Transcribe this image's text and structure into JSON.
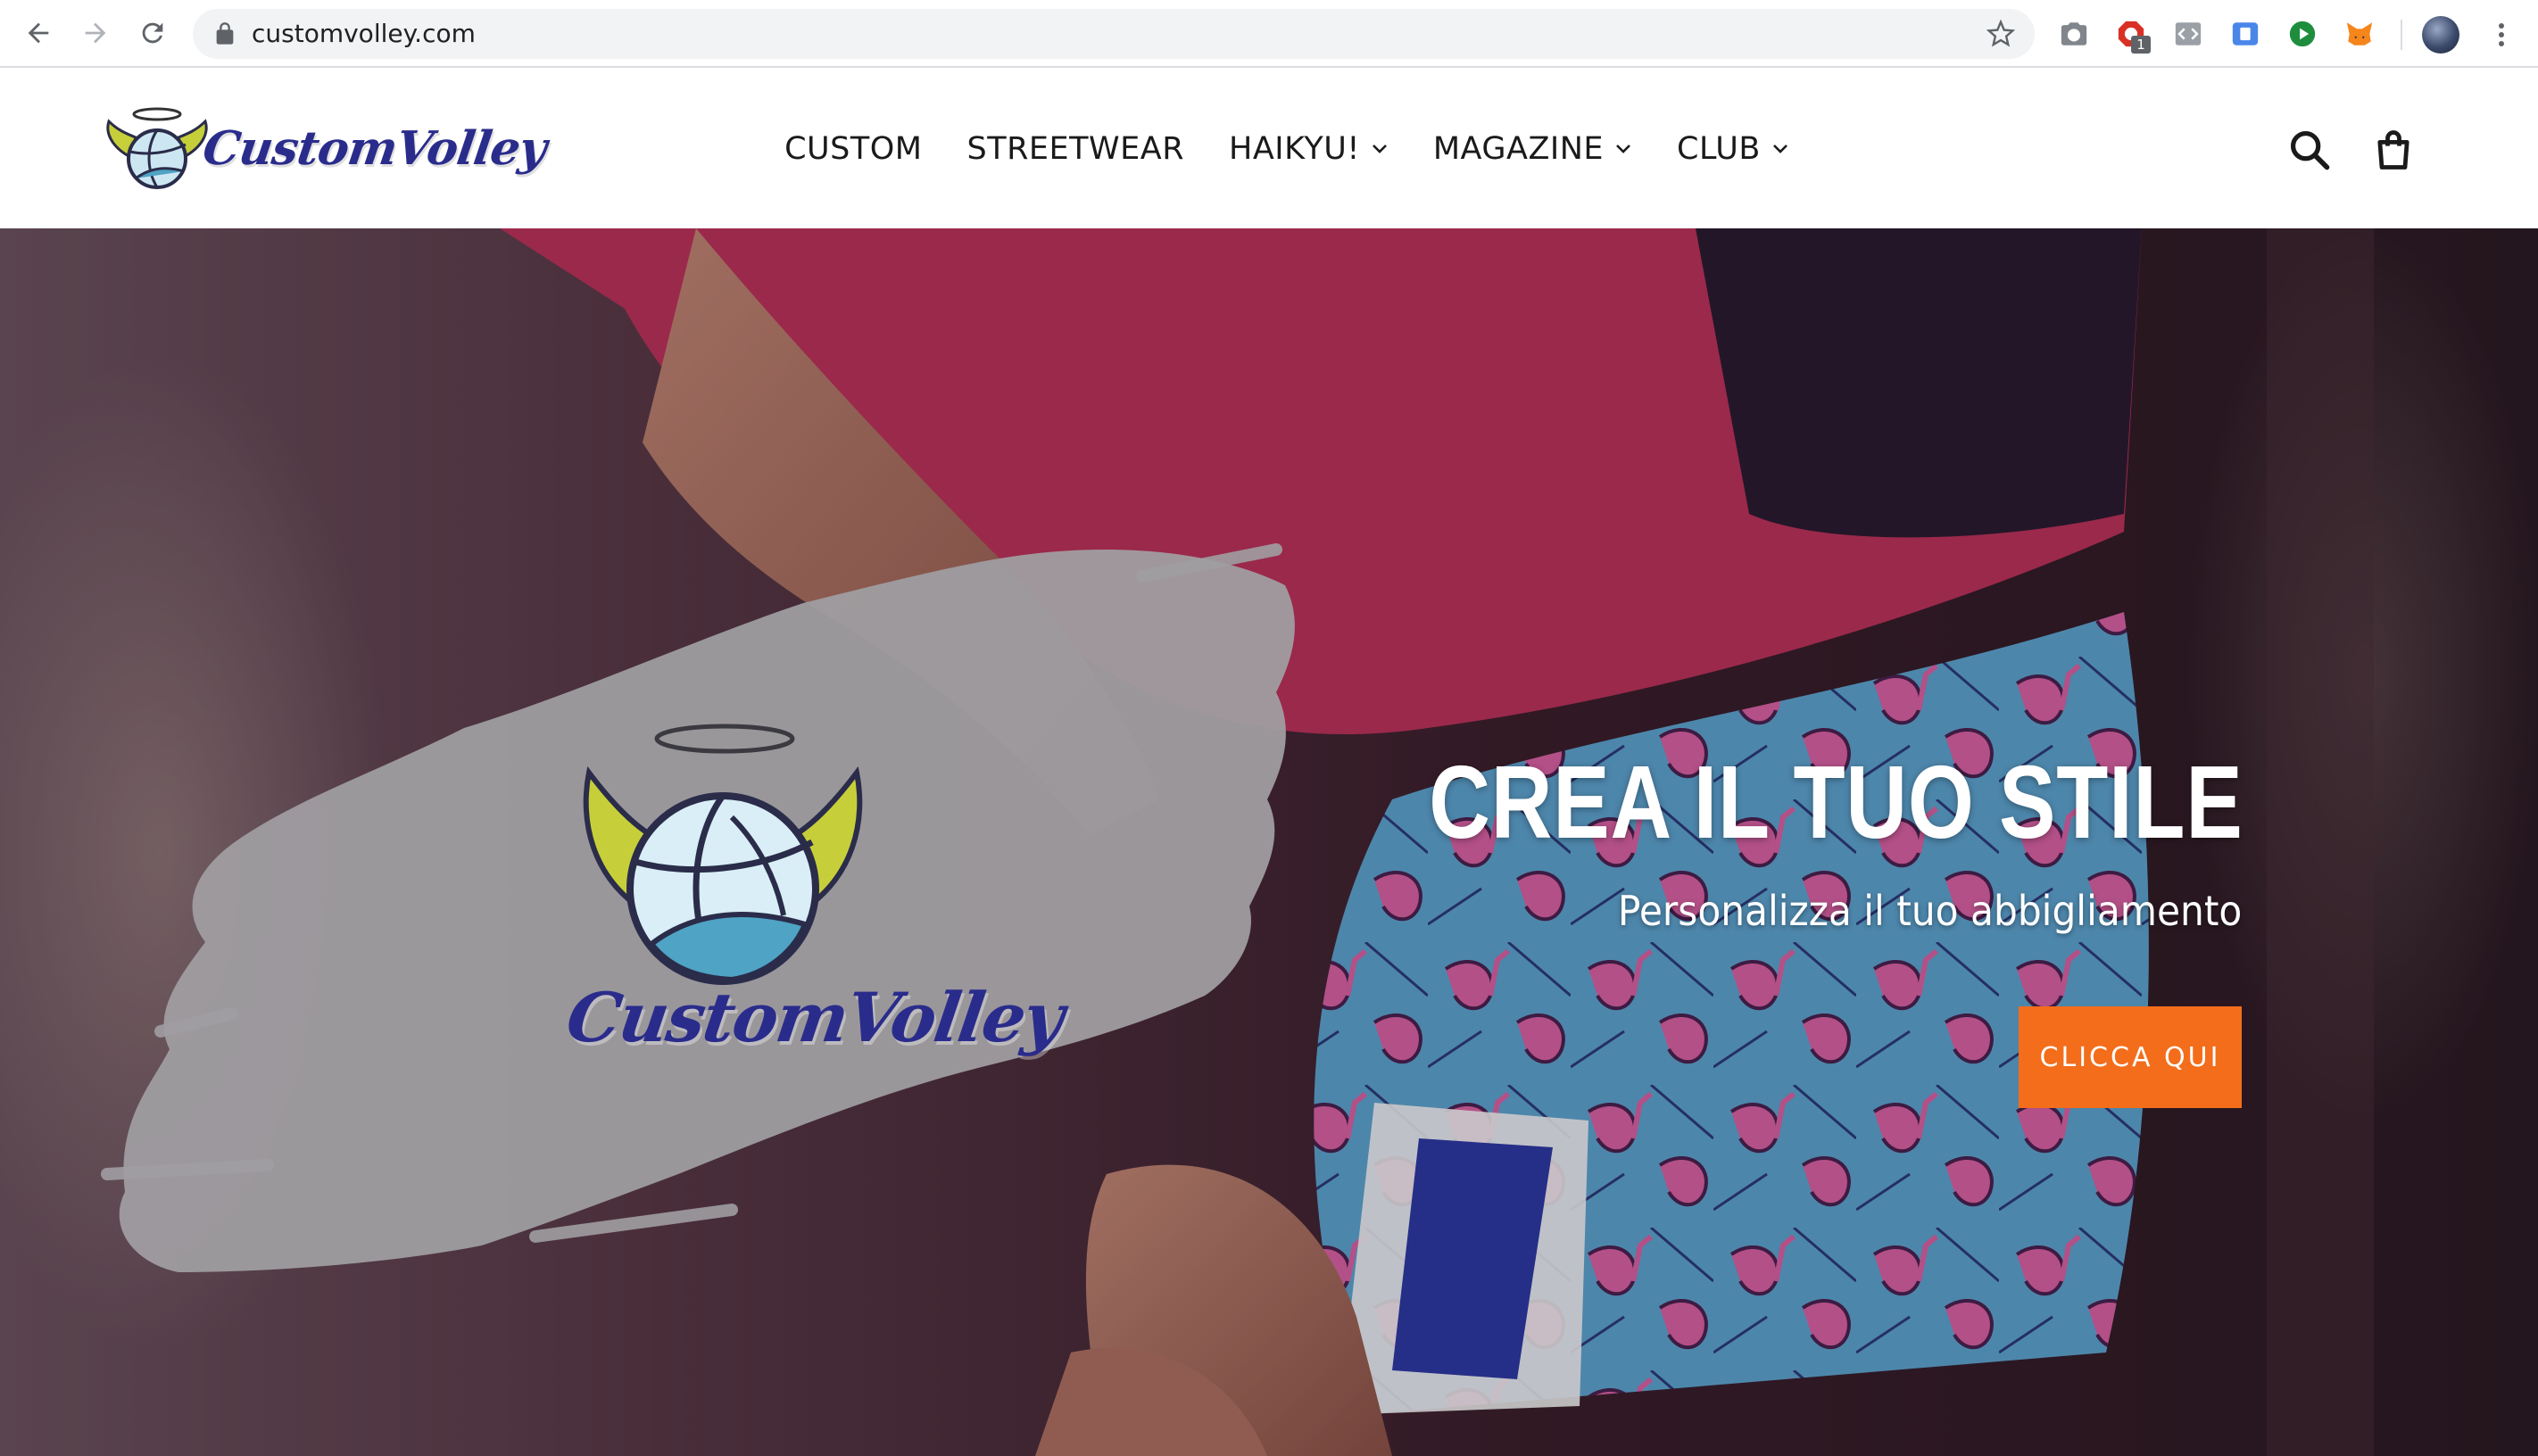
{
  "browser": {
    "url": "customvolley.com",
    "extension_badge": "1"
  },
  "site": {
    "brand": "CustomVolley",
    "nav": [
      {
        "label": "CUSTOM",
        "dropdown": false
      },
      {
        "label": "STREETWEAR",
        "dropdown": false
      },
      {
        "label": "HAIKYU!",
        "dropdown": true
      },
      {
        "label": "MAGAZINE",
        "dropdown": true
      },
      {
        "label": "CLUB",
        "dropdown": true
      }
    ]
  },
  "hero": {
    "title": "CREA IL TUO STILE",
    "subtitle": "Personalizza il tuo abbigliamento",
    "cta_label": "CLICCA QUI",
    "brand": "CustomVolley"
  },
  "colors": {
    "cta": "#f36d1b",
    "brand_blue": "#2a2c8c",
    "wing_yellow": "#c6cf3a",
    "ball_teal": "#4fa3c4"
  },
  "icons": [
    "back-arrow-icon",
    "forward-arrow-icon",
    "reload-icon",
    "lock-icon",
    "star-icon",
    "camera-icon",
    "search-icon",
    "cart-icon",
    "chevron-down-icon"
  ]
}
